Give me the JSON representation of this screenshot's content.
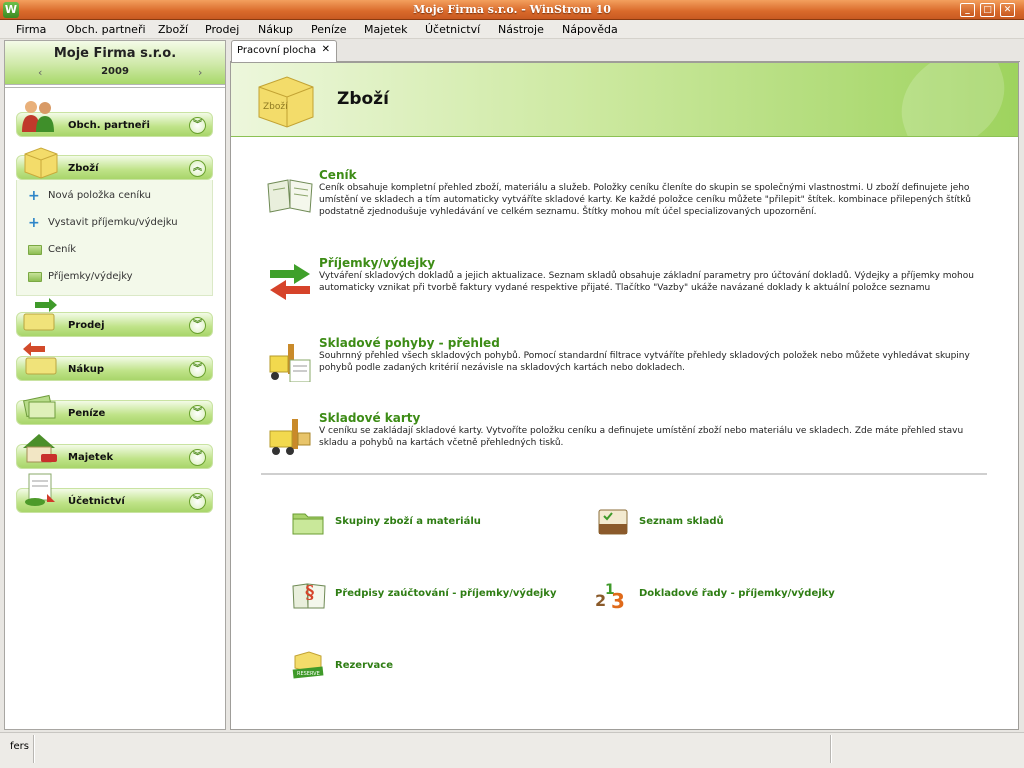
{
  "window": {
    "title": "Moje Firma s.r.o. - WinStrom 10",
    "app_icon_letter": "W",
    "controls": {
      "minimize": "_",
      "maximize": "□",
      "close": "✕"
    }
  },
  "menu": [
    "Firma",
    "Obch. partneři",
    "Zboží",
    "Prodej",
    "Nákup",
    "Peníze",
    "Majetek",
    "Účetnictví",
    "Nástroje",
    "Nápověda"
  ],
  "company": {
    "name": "Moje Firma s.r.o.",
    "year": "2009",
    "prev": "‹",
    "next": "›"
  },
  "nav": {
    "categories": [
      {
        "label": "Obch. partneři",
        "icon": "partners-icon",
        "expanded": false
      },
      {
        "label": "Zboží",
        "icon": "goods-box-icon",
        "expanded": true
      },
      {
        "label": "Prodej",
        "icon": "sales-icon",
        "expanded": false
      },
      {
        "label": "Nákup",
        "icon": "purchase-icon",
        "expanded": false
      },
      {
        "label": "Peníze",
        "icon": "money-icon",
        "expanded": false
      },
      {
        "label": "Majetek",
        "icon": "property-house-icon",
        "expanded": false
      },
      {
        "label": "Účetnictví",
        "icon": "accounting-icon",
        "expanded": false
      }
    ],
    "sub_items": [
      {
        "label": "Nová položka ceníku",
        "icon": "plus-icon"
      },
      {
        "label": "Vystavit příjemku/výdejku",
        "icon": "plus-icon"
      },
      {
        "label": "Ceník",
        "icon": "folder-icon"
      },
      {
        "label": "Příjemky/výdejky",
        "icon": "folder-icon"
      }
    ],
    "toggle_down": "︾",
    "toggle_up": "︽"
  },
  "tab": {
    "label": "Pracovní plocha",
    "close": "✕"
  },
  "banner": {
    "title": "Zboží",
    "icon_text": "Zboží"
  },
  "sections": [
    {
      "title": "Ceník",
      "icon": "pricelist-book-icon",
      "desc": "Ceník obsahuje kompletní přehled zboží, materiálu a služeb. Položky ceníku členíte do skupin se společnými vlastnostmi. U zboží definujete jeho umístění ve skladech a tím automaticky vytváříte skladové karty. Ke každé položce ceníku můžete \"přilepit\" štítek. kombinace přilepených štítků podstatně zjednodušuje vyhledávání ve celkém seznamu. Štítky mohou mít účel specializovaných upozornění."
    },
    {
      "title": "Příjemky/výdejky",
      "icon": "in-out-arrows-icon",
      "desc": "Vytváření skladových dokladů a jejich aktualizace. Seznam skladů obsahuje základní parametry pro účtování dokladů. Výdejky a příjemky mohou automaticky vznikat při tvorbě faktury vydané respektive přijaté. Tlačítko \"Vazby\" ukáže navázané doklady k aktuální položce seznamu"
    },
    {
      "title": "Skladové pohyby - přehled",
      "icon": "forklift-list-icon",
      "desc": "Souhrnný přehled všech skladových pohybů. Pomocí standardní filtrace vytváříte přehledy skladových položek nebo můžete vyhledávat skupiny pohybů podle zadaných kritérií nezávisle na skladových kartách nebo dokladech."
    },
    {
      "title": "Skladové karty",
      "icon": "forklift-icon",
      "desc": "V ceníku se zakládají skladové karty. Vytvoříte položku ceníku a definujete umístění zboží nebo materiálu ve skladech. Zde máte přehled stavu skladu a pohybů na kartách včetně přehledných tisků."
    }
  ],
  "links": [
    {
      "label": "Skupiny zboží a materiálu",
      "icon": "folder-group-icon"
    },
    {
      "label": "Seznam skladů",
      "icon": "warehouse-list-icon"
    },
    {
      "label": "Předpisy zaúčtování - příjemky/výdejky",
      "icon": "accounting-rules-icon"
    },
    {
      "label": "Dokladové řady - příjemky/výdejky",
      "icon": "number-series-icon"
    },
    {
      "label": "Rezervace",
      "icon": "reservation-icon",
      "badge": "RESERVE"
    }
  ],
  "status": {
    "text": "fers"
  }
}
